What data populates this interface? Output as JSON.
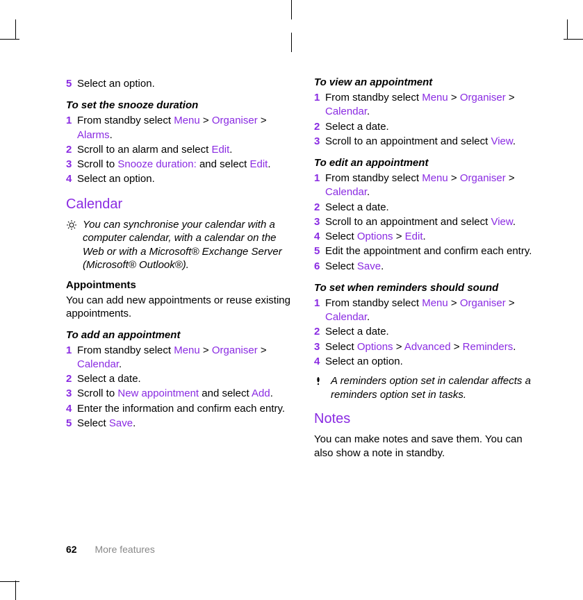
{
  "footer": {
    "page": "62",
    "section": "More features"
  },
  "left": {
    "step5": {
      "n": "5",
      "t": "Select an option."
    },
    "snooze": {
      "title": "To set the snooze duration",
      "s1": {
        "n": "1",
        "pre": "From standby select ",
        "m": "Menu",
        "gt1": " > ",
        "o": "Organiser",
        "gt2": " > ",
        "a": "Alarms",
        "post": "."
      },
      "s2": {
        "n": "2",
        "pre": "Scroll to an alarm and select ",
        "e": "Edit",
        "post": "."
      },
      "s3": {
        "n": "3",
        "pre": "Scroll to ",
        "sd": "Snooze duration:",
        "mid": " and select ",
        "e": "Edit",
        "post": "."
      },
      "s4": {
        "n": "4",
        "t": "Select an option."
      }
    },
    "calendar": {
      "heading": "Calendar",
      "tip": "You can synchronise your calendar with a computer calendar, with a calendar on the Web or with a Microsoft® Exchange Server (Microsoft® Outlook®).",
      "appts_h": "Appointments",
      "appts_p": "You can add new appointments or reuse existing appointments."
    },
    "add": {
      "title": "To add an appointment",
      "s1": {
        "n": "1",
        "pre": "From standby select ",
        "m": "Menu",
        "gt1": " > ",
        "o": "Organiser",
        "gt2": " > ",
        "c": "Calendar",
        "post": "."
      },
      "s2": {
        "n": "2",
        "t": "Select a date."
      },
      "s3": {
        "n": "3",
        "pre": "Scroll to ",
        "na": "New appointment",
        "mid": " and select ",
        "ad": "Add",
        "post": "."
      },
      "s4": {
        "n": "4",
        "t": "Enter the information and confirm each entry."
      },
      "s5": {
        "n": "5",
        "pre": "Select ",
        "sv": "Save",
        "post": "."
      }
    }
  },
  "right": {
    "view": {
      "title": "To view an appointment",
      "s1": {
        "n": "1",
        "pre": "From standby select ",
        "m": "Menu",
        "gt1": " > ",
        "o": "Organiser",
        "gt2": " > ",
        "c": "Calendar",
        "post": "."
      },
      "s2": {
        "n": "2",
        "t": "Select a date."
      },
      "s3": {
        "n": "3",
        "pre": "Scroll to an appointment and select ",
        "v": "View",
        "post": "."
      }
    },
    "edit": {
      "title": "To edit an appointment",
      "s1": {
        "n": "1",
        "pre": "From standby select ",
        "m": "Menu",
        "gt1": " > ",
        "o": "Organiser",
        "gt2": " > ",
        "c": "Calendar",
        "post": "."
      },
      "s2": {
        "n": "2",
        "t": "Select a date."
      },
      "s3": {
        "n": "3",
        "pre": "Scroll to an appointment and select ",
        "v": "View",
        "post": "."
      },
      "s4": {
        "n": "4",
        "pre": "Select ",
        "op": "Options",
        "gt": " > ",
        "e": "Edit",
        "post": "."
      },
      "s5": {
        "n": "5",
        "t": "Edit the appointment and confirm each entry."
      },
      "s6": {
        "n": "6",
        "pre": "Select ",
        "sv": "Save",
        "post": "."
      }
    },
    "rem": {
      "title": "To set when reminders should sound",
      "s1": {
        "n": "1",
        "pre": "From standby select ",
        "m": "Menu",
        "gt1": " > ",
        "o": "Organiser",
        "gt2": " > ",
        "c": "Calendar",
        "post": "."
      },
      "s2": {
        "n": "2",
        "t": "Select a date."
      },
      "s3": {
        "n": "3",
        "pre": "Select ",
        "op": "Options",
        "gt1": " > ",
        "adv": "Advanced",
        "gt2": " > ",
        "r": "Reminders",
        "post": "."
      },
      "s4": {
        "n": "4",
        "t": "Select an option."
      },
      "warn": "A reminders option set in calendar affects a reminders option set in tasks."
    },
    "notes": {
      "heading": "Notes",
      "p": "You can make notes and save them. You can also show a note in standby."
    }
  }
}
